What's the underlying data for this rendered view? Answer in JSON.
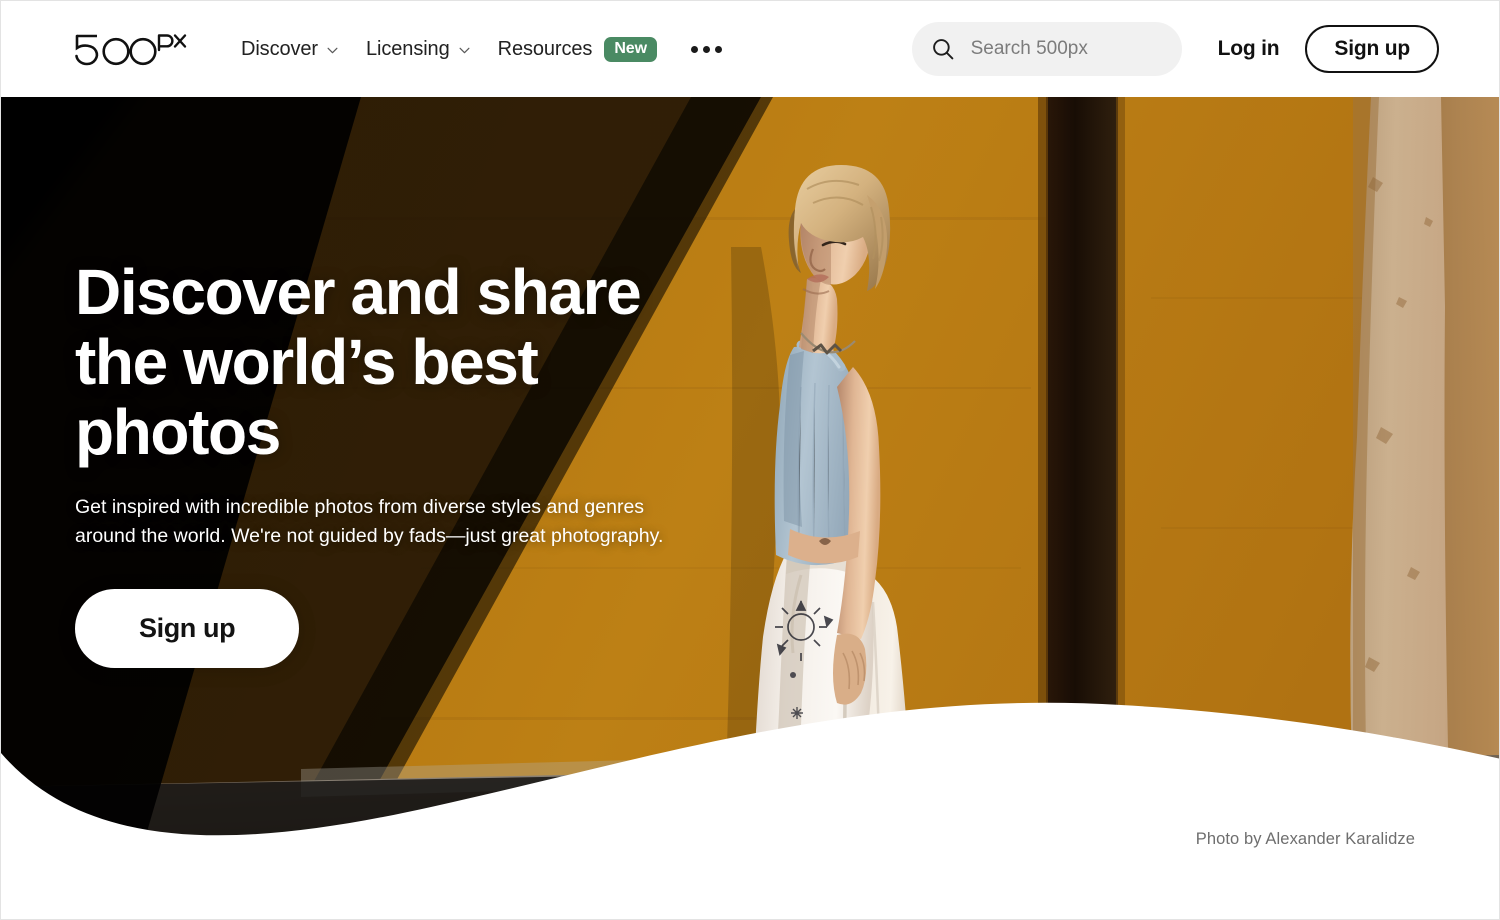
{
  "site": {
    "logo_text": "500px",
    "logo_icon": "500px-wordmark-logo"
  },
  "header": {
    "nav": [
      {
        "label": "Discover",
        "icon": "chevron-down-icon",
        "has_caret": true,
        "badge": null
      },
      {
        "label": "Licensing",
        "icon": "chevron-down-icon",
        "has_caret": true,
        "badge": null
      },
      {
        "label": "Resources",
        "icon": null,
        "has_caret": false,
        "badge": "New"
      }
    ],
    "more_icon": "ellipsis-horizontal-icon",
    "search": {
      "icon": "search-icon",
      "placeholder": "Search 500px",
      "value": ""
    },
    "login_label": "Log in",
    "signup_label": "Sign up"
  },
  "hero": {
    "title": "Discover and share\nthe world’s best\nphotos",
    "subtitle": "Get inspired with incredible photos from diverse styles and genres\naround the world. We're not guided by fads—just great photography.",
    "cta_label": "Sign up",
    "photo_credit": "Photo by Alexander Karalidze",
    "photo_description": "Blonde woman in a light blue tank top and white wide-leg embroidered pants standing against a sunlit ochre-orange wall with a dark vertical shadow stripe and a weathered stone wall at right"
  },
  "colors": {
    "badge_green": "#4a8a63",
    "wall_orange": "#b67a16",
    "wall_orange_shadow": "#8d5d12",
    "dark_stripe": "#1e1109",
    "stone_beige": "#c9ab88",
    "stone_shadow": "#a9793f",
    "ground_gray": "#6d6257",
    "black": "#000000",
    "white": "#ffffff",
    "search_bg": "#f1f1f1",
    "placeholder_gray": "#7c7c7c",
    "credit_gray": "#6e6e6e",
    "tank_blue": "#a9bccb",
    "hair_blonde": "#d8b98a",
    "skin": "#e2bb9a"
  }
}
